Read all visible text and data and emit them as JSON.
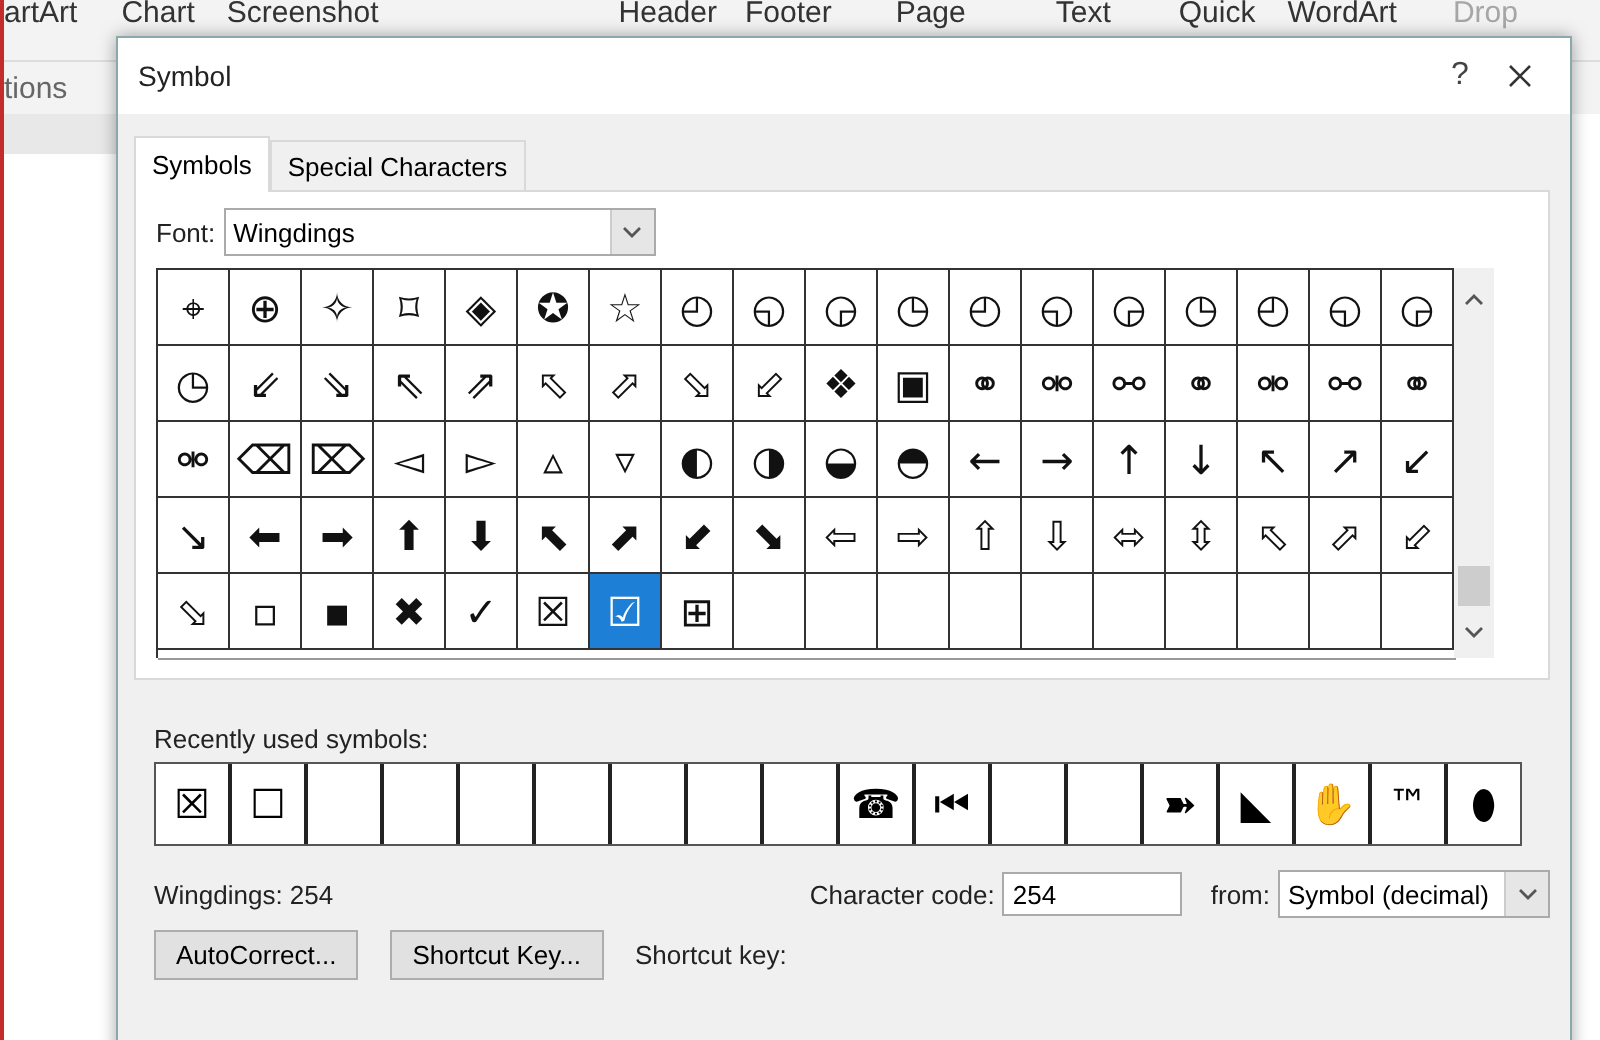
{
  "ribbon": {
    "items": [
      {
        "label": "artArt",
        "disabled": false
      },
      {
        "label": "Chart",
        "disabled": false
      },
      {
        "label": "Screenshot",
        "disabled": false
      },
      {
        "label": "Header",
        "disabled": false
      },
      {
        "label": "Footer",
        "disabled": false
      },
      {
        "label": "Page",
        "disabled": false
      },
      {
        "label": "Text",
        "disabled": false
      },
      {
        "label": "Quick",
        "disabled": false
      },
      {
        "label": "WordArt",
        "disabled": false
      },
      {
        "label": "Drop",
        "disabled": true
      }
    ],
    "group_label": "tions"
  },
  "dialog": {
    "title": "Symbol",
    "help": "?",
    "tabs": [
      {
        "label": "Symbols",
        "selected": true
      },
      {
        "label": "Special Characters",
        "selected": false
      }
    ],
    "font": {
      "label": "Font:",
      "value": "Wingdings"
    },
    "symbols": [
      {
        "glyph": "⌖",
        "selected": false
      },
      {
        "glyph": "⊕",
        "selected": false
      },
      {
        "glyph": "✧",
        "selected": false
      },
      {
        "glyph": "⌑",
        "selected": false
      },
      {
        "glyph": "◈",
        "selected": false
      },
      {
        "glyph": "✪",
        "selected": false
      },
      {
        "glyph": "☆",
        "selected": false
      },
      {
        "glyph": "◴",
        "selected": false
      },
      {
        "glyph": "◵",
        "selected": false
      },
      {
        "glyph": "◶",
        "selected": false
      },
      {
        "glyph": "◷",
        "selected": false
      },
      {
        "glyph": "◴",
        "selected": false
      },
      {
        "glyph": "◵",
        "selected": false
      },
      {
        "glyph": "◶",
        "selected": false
      },
      {
        "glyph": "◷",
        "selected": false
      },
      {
        "glyph": "◴",
        "selected": false
      },
      {
        "glyph": "◵",
        "selected": false
      },
      {
        "glyph": "◶",
        "selected": false
      },
      {
        "glyph": "◷",
        "selected": false
      },
      {
        "glyph": "⇙",
        "selected": false
      },
      {
        "glyph": "⇘",
        "selected": false
      },
      {
        "glyph": "⇖",
        "selected": false
      },
      {
        "glyph": "⇗",
        "selected": false
      },
      {
        "glyph": "⬁",
        "selected": false
      },
      {
        "glyph": "⬀",
        "selected": false
      },
      {
        "glyph": "⬂",
        "selected": false
      },
      {
        "glyph": "⬃",
        "selected": false
      },
      {
        "glyph": "❖",
        "selected": false
      },
      {
        "glyph": "▣",
        "selected": false
      },
      {
        "glyph": "⚭",
        "selected": false
      },
      {
        "glyph": "⚮",
        "selected": false
      },
      {
        "glyph": "⚯",
        "selected": false
      },
      {
        "glyph": "⚭",
        "selected": false
      },
      {
        "glyph": "⚮",
        "selected": false
      },
      {
        "glyph": "⚯",
        "selected": false
      },
      {
        "glyph": "⚭",
        "selected": false
      },
      {
        "glyph": "⚮",
        "selected": false
      },
      {
        "glyph": "⌫",
        "selected": false
      },
      {
        "glyph": "⌦",
        "selected": false
      },
      {
        "glyph": "◅",
        "selected": false
      },
      {
        "glyph": "▻",
        "selected": false
      },
      {
        "glyph": "▵",
        "selected": false
      },
      {
        "glyph": "▿",
        "selected": false
      },
      {
        "glyph": "◐",
        "selected": false
      },
      {
        "glyph": "◑",
        "selected": false
      },
      {
        "glyph": "◒",
        "selected": false
      },
      {
        "glyph": "◓",
        "selected": false
      },
      {
        "glyph": "←",
        "selected": false
      },
      {
        "glyph": "→",
        "selected": false
      },
      {
        "glyph": "↑",
        "selected": false
      },
      {
        "glyph": "↓",
        "selected": false
      },
      {
        "glyph": "↖",
        "selected": false
      },
      {
        "glyph": "↗",
        "selected": false
      },
      {
        "glyph": "↙",
        "selected": false
      },
      {
        "glyph": "↘",
        "selected": false
      },
      {
        "glyph": "⬅",
        "selected": false
      },
      {
        "glyph": "➡",
        "selected": false
      },
      {
        "glyph": "⬆",
        "selected": false
      },
      {
        "glyph": "⬇",
        "selected": false
      },
      {
        "glyph": "⬉",
        "selected": false
      },
      {
        "glyph": "⬈",
        "selected": false
      },
      {
        "glyph": "⬋",
        "selected": false
      },
      {
        "glyph": "⬊",
        "selected": false
      },
      {
        "glyph": "⇦",
        "selected": false
      },
      {
        "glyph": "⇨",
        "selected": false
      },
      {
        "glyph": "⇧",
        "selected": false
      },
      {
        "glyph": "⇩",
        "selected": false
      },
      {
        "glyph": "⬄",
        "selected": false
      },
      {
        "glyph": "⇳",
        "selected": false
      },
      {
        "glyph": "⬁",
        "selected": false
      },
      {
        "glyph": "⬀",
        "selected": false
      },
      {
        "glyph": "⬃",
        "selected": false
      },
      {
        "glyph": "⬂",
        "selected": false
      },
      {
        "glyph": "▫",
        "selected": false
      },
      {
        "glyph": "▪",
        "selected": false
      },
      {
        "glyph": "✖",
        "selected": false
      },
      {
        "glyph": "✓",
        "selected": false
      },
      {
        "glyph": "☒",
        "selected": false
      },
      {
        "glyph": "☑",
        "selected": true
      },
      {
        "glyph": "⊞",
        "selected": false
      }
    ],
    "recent_label": "Recently used symbols:",
    "recent": [
      {
        "kind": "glyph",
        "glyph": "☒"
      },
      {
        "kind": "glyph",
        "glyph": "☐"
      },
      {
        "kind": "blank"
      },
      {
        "kind": "blank"
      },
      {
        "kind": "blank"
      },
      {
        "kind": "blank"
      },
      {
        "kind": "blank"
      },
      {
        "kind": "blank"
      },
      {
        "kind": "blank"
      },
      {
        "kind": "glyph",
        "glyph": "☎"
      },
      {
        "kind": "glyph",
        "glyph": "⏮"
      },
      {
        "kind": "blank"
      },
      {
        "kind": "blank"
      },
      {
        "kind": "glyph",
        "glyph": "➽"
      },
      {
        "kind": "glyph",
        "glyph": "◣"
      },
      {
        "kind": "glyph",
        "glyph": "✋"
      },
      {
        "kind": "glyph",
        "glyph": "™"
      },
      {
        "kind": "glyph",
        "glyph": "⬮"
      }
    ],
    "symbol_name": "Wingdings: 254",
    "character_code": {
      "label": "Character code:",
      "value": "254"
    },
    "from": {
      "label": "from:",
      "value": "Symbol (decimal)"
    },
    "buttons": [
      "AutoCorrect...",
      "Shortcut Key..."
    ],
    "shortcut_label": "Shortcut key:"
  }
}
